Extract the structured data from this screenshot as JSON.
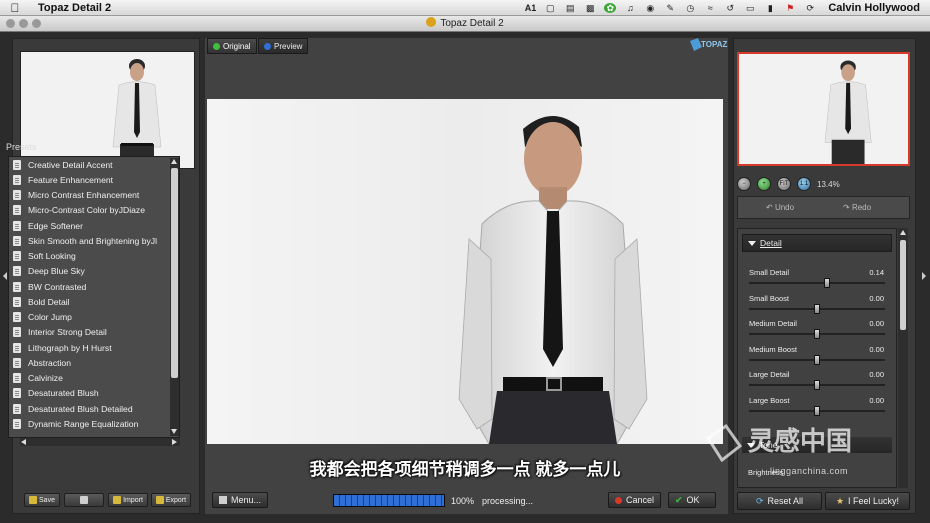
{
  "menubar": {
    "app_name": "Topaz Detail 2",
    "status_icons": [
      "adobe-icon",
      "number-icon",
      "window-icon",
      "stack-icon",
      "display-icon",
      "evernote-icon",
      "volume-icon",
      "notification-icon",
      "script-icon",
      "clock-icon",
      "wifi-icon",
      "history-icon",
      "monitor-icon",
      "battery-icon",
      "flag-icon",
      "sync-icon"
    ],
    "adobe_label": "A",
    "adobe_count": "1",
    "user_name": "Calvin  Hollywood"
  },
  "window": {
    "title": "Topaz Detail 2"
  },
  "left_panel": {
    "presets_title": "Presets",
    "presets": [
      "Creative Detail Accent",
      "Feature Enhancement",
      "Micro Contrast Enhancement",
      "Micro-Contrast Color byJDiaze",
      "Edge Softener",
      "Skin Smooth and Brightening byJl",
      "Soft Looking",
      "Deep Blue Sky",
      "BW Contrasted",
      "Bold Detail",
      "Color Jump",
      "Interior Strong Detail",
      "Lithograph by H Hurst",
      "Abstraction",
      "Calvinize",
      "Desaturated Blush",
      "Desaturated Blush Detailed",
      "Dynamic Range Equalization"
    ],
    "buttons": {
      "save": "Save",
      "import": "Import",
      "export": "Export"
    }
  },
  "center": {
    "tabs": {
      "original": "Original",
      "preview": "Preview"
    },
    "subtitle": "我都会把各项细节稍调多一点 就多一点儿",
    "menu_button": "Menu...",
    "progress_percent": 100,
    "progress_label": "100%",
    "status_text": "processing...",
    "cancel_button": "Cancel",
    "ok_button": "OK",
    "logo_text": "TOPAZ"
  },
  "right_panel": {
    "zoom_buttons": [
      "zoom-out",
      "zoom-in",
      "FIT",
      "1:1"
    ],
    "zoom_labels": {
      "fit": "FIT",
      "one_to_one": "1:1"
    },
    "zoom_value": "13.4%",
    "undo": "Undo",
    "redo": "Redo",
    "detail_section": "Detail",
    "sliders": [
      {
        "name": "Small Detail",
        "value": "0.14",
        "level": 0.57
      },
      {
        "name": "Small Boost",
        "value": "0.00",
        "level": 0.5
      },
      {
        "name": "Medium Detail",
        "value": "0.00",
        "level": 0.5
      },
      {
        "name": "Medium Boost",
        "value": "0.00",
        "level": 0.5
      },
      {
        "name": "Large Detail",
        "value": "0.00",
        "level": 0.5
      },
      {
        "name": "Large Boost",
        "value": "0.00",
        "level": 0.5
      }
    ],
    "tone_section": "Tone",
    "tone_first_row": "Brightness",
    "reset_all": "Reset All",
    "feel_lucky": "I Feel Lucky!"
  },
  "watermark": {
    "title": "灵感中国",
    "url": "lingganchina.com"
  },
  "colors": {
    "accent_red": "#d63a2a",
    "progress_blue": "#2f6fd6",
    "original_dot": "#3fbf3f",
    "preview_dot": "#2f6fd6",
    "cancel_red": "#d83a2a",
    "ok_green": "#3fae3f"
  }
}
